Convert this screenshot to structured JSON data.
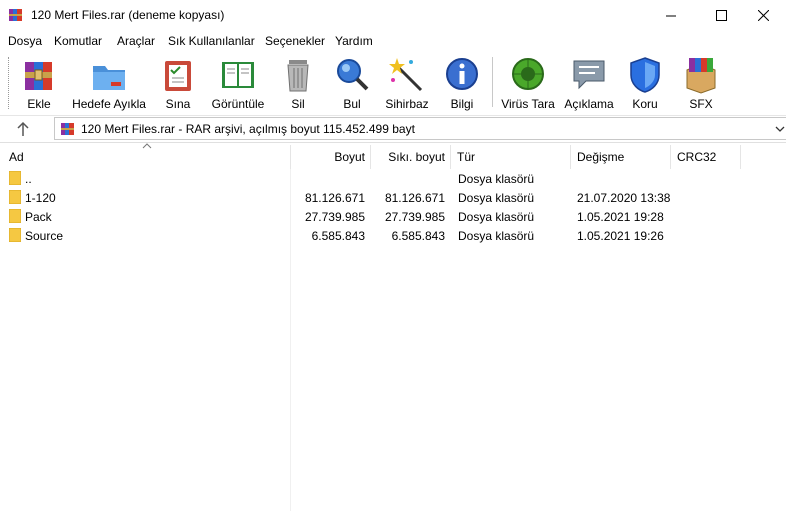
{
  "window": {
    "title": "120 Mert Files.rar (deneme kopyası)"
  },
  "menu": [
    "Dosya",
    "Komutlar",
    "Araçlar",
    "Sık Kullanılanlar",
    "Seçenekler",
    "Yardım"
  ],
  "toolbar": {
    "buttons": [
      {
        "label": "Ekle",
        "icon": "add-archive-icon"
      },
      {
        "label": "Hedefe Ayıkla",
        "icon": "extract-folder-icon"
      },
      {
        "label": "Sına",
        "icon": "test-clipboard-icon"
      },
      {
        "label": "Görüntüle",
        "icon": "view-book-icon"
      },
      {
        "label": "Sil",
        "icon": "trash-icon"
      },
      {
        "label": "Bul",
        "icon": "magnifier-icon"
      },
      {
        "label": "Sihirbaz",
        "icon": "wizard-wand-icon"
      },
      {
        "label": "Bilgi",
        "icon": "info-icon"
      },
      {
        "label": "Virüs Tara",
        "icon": "virus-scan-icon"
      },
      {
        "label": "Açıklama",
        "icon": "comment-icon"
      },
      {
        "label": "Koru",
        "icon": "shield-icon"
      },
      {
        "label": "SFX",
        "icon": "sfx-box-icon"
      }
    ]
  },
  "path": {
    "text": "120 Mert Files.rar - RAR arşivi, açılmış boyut 115.452.499 bayt"
  },
  "columns": {
    "name": "Ad",
    "size": "Boyut",
    "packed": "Sıkı. boyut",
    "type": "Tür",
    "modified": "Değişme",
    "crc": "CRC32"
  },
  "files": [
    {
      "name": "..",
      "size": "",
      "packed": "",
      "type": "Dosya klasörü",
      "modified": ""
    },
    {
      "name": "1-120",
      "size": "81.126.671",
      "packed": "81.126.671",
      "type": "Dosya klasörü",
      "modified": "21.07.2020 13:38"
    },
    {
      "name": "Pack",
      "size": "27.739.985",
      "packed": "27.739.985",
      "type": "Dosya klasörü",
      "modified": "1.05.2021 19:28"
    },
    {
      "name": "Source",
      "size": "6.585.843",
      "packed": "6.585.843",
      "type": "Dosya klasörü",
      "modified": "1.05.2021 19:26"
    }
  ],
  "colors": {
    "folder": "#f5c842",
    "selection": "#cce8ff"
  }
}
